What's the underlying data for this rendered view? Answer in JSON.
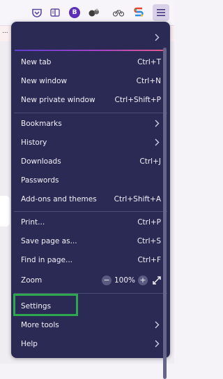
{
  "toolbar": {
    "profile_initial": "B",
    "icons": [
      "pocket-icon",
      "reader-view-icon",
      "profile-avatar-icon",
      "extension-icon",
      "bike-icon",
      "colorful-s-icon",
      "menu-icon"
    ]
  },
  "page": {
    "dots": "..."
  },
  "menu": {
    "items": [
      {
        "label": "New tab",
        "shortcut": "Ctrl+T"
      },
      {
        "label": "New window",
        "shortcut": "Ctrl+N"
      },
      {
        "label": "New private window",
        "shortcut": "Ctrl+Shift+P"
      },
      {
        "label": "Bookmarks",
        "shortcut": ""
      },
      {
        "label": "History",
        "shortcut": ""
      },
      {
        "label": "Downloads",
        "shortcut": "Ctrl+J"
      },
      {
        "label": "Passwords",
        "shortcut": ""
      },
      {
        "label": "Add-ons and themes",
        "shortcut": "Ctrl+Shift+A"
      },
      {
        "label": "Print...",
        "shortcut": "Ctrl+P"
      },
      {
        "label": "Save page as...",
        "shortcut": "Ctrl+S"
      },
      {
        "label": "Find in page...",
        "shortcut": "Ctrl+F"
      },
      {
        "label": "Zoom",
        "shortcut": ""
      },
      {
        "label": "Settings",
        "shortcut": ""
      },
      {
        "label": "More tools",
        "shortcut": ""
      },
      {
        "label": "Help",
        "shortcut": ""
      }
    ],
    "zoom": {
      "minus": "−",
      "value": "100%",
      "plus": "+"
    }
  },
  "colors": {
    "panel_bg": "#2b2a54",
    "highlight": "#2ea84f",
    "account_gradient": [
      "#5b3fcf",
      "#a642c6",
      "#e35a8b"
    ]
  }
}
